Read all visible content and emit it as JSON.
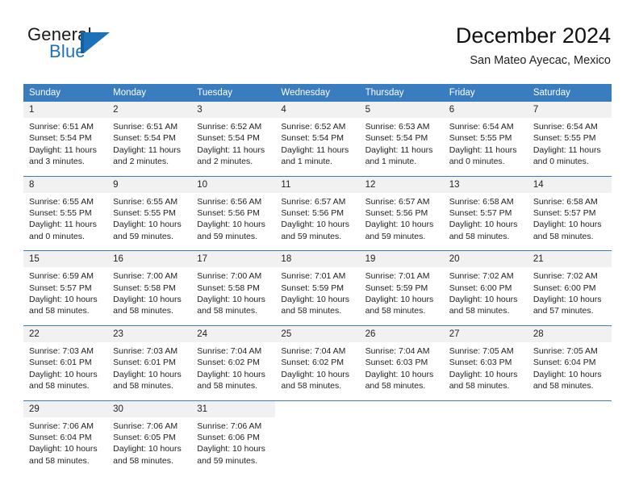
{
  "brand": {
    "name_top": "General",
    "name_bottom": "Blue",
    "accent_color": "#1d71b8",
    "mark_icon": "triangle-logo-icon"
  },
  "header": {
    "title": "December 2024",
    "subtitle": "San Mateo Ayecac, Mexico"
  },
  "calendar": {
    "header_color": "#3a7cc0",
    "daynum_bg": "#f1f1f1",
    "weekday_headers": [
      "Sunday",
      "Monday",
      "Tuesday",
      "Wednesday",
      "Thursday",
      "Friday",
      "Saturday"
    ],
    "weeks": [
      [
        {
          "day": "1",
          "sunrise": "Sunrise: 6:51 AM",
          "sunset": "Sunset: 5:54 PM",
          "daylight": "Daylight: 11 hours and 3 minutes."
        },
        {
          "day": "2",
          "sunrise": "Sunrise: 6:51 AM",
          "sunset": "Sunset: 5:54 PM",
          "daylight": "Daylight: 11 hours and 2 minutes."
        },
        {
          "day": "3",
          "sunrise": "Sunrise: 6:52 AM",
          "sunset": "Sunset: 5:54 PM",
          "daylight": "Daylight: 11 hours and 2 minutes."
        },
        {
          "day": "4",
          "sunrise": "Sunrise: 6:52 AM",
          "sunset": "Sunset: 5:54 PM",
          "daylight": "Daylight: 11 hours and 1 minute."
        },
        {
          "day": "5",
          "sunrise": "Sunrise: 6:53 AM",
          "sunset": "Sunset: 5:54 PM",
          "daylight": "Daylight: 11 hours and 1 minute."
        },
        {
          "day": "6",
          "sunrise": "Sunrise: 6:54 AM",
          "sunset": "Sunset: 5:55 PM",
          "daylight": "Daylight: 11 hours and 0 minutes."
        },
        {
          "day": "7",
          "sunrise": "Sunrise: 6:54 AM",
          "sunset": "Sunset: 5:55 PM",
          "daylight": "Daylight: 11 hours and 0 minutes."
        }
      ],
      [
        {
          "day": "8",
          "sunrise": "Sunrise: 6:55 AM",
          "sunset": "Sunset: 5:55 PM",
          "daylight": "Daylight: 11 hours and 0 minutes."
        },
        {
          "day": "9",
          "sunrise": "Sunrise: 6:55 AM",
          "sunset": "Sunset: 5:55 PM",
          "daylight": "Daylight: 10 hours and 59 minutes."
        },
        {
          "day": "10",
          "sunrise": "Sunrise: 6:56 AM",
          "sunset": "Sunset: 5:56 PM",
          "daylight": "Daylight: 10 hours and 59 minutes."
        },
        {
          "day": "11",
          "sunrise": "Sunrise: 6:57 AM",
          "sunset": "Sunset: 5:56 PM",
          "daylight": "Daylight: 10 hours and 59 minutes."
        },
        {
          "day": "12",
          "sunrise": "Sunrise: 6:57 AM",
          "sunset": "Sunset: 5:56 PM",
          "daylight": "Daylight: 10 hours and 59 minutes."
        },
        {
          "day": "13",
          "sunrise": "Sunrise: 6:58 AM",
          "sunset": "Sunset: 5:57 PM",
          "daylight": "Daylight: 10 hours and 58 minutes."
        },
        {
          "day": "14",
          "sunrise": "Sunrise: 6:58 AM",
          "sunset": "Sunset: 5:57 PM",
          "daylight": "Daylight: 10 hours and 58 minutes."
        }
      ],
      [
        {
          "day": "15",
          "sunrise": "Sunrise: 6:59 AM",
          "sunset": "Sunset: 5:57 PM",
          "daylight": "Daylight: 10 hours and 58 minutes."
        },
        {
          "day": "16",
          "sunrise": "Sunrise: 7:00 AM",
          "sunset": "Sunset: 5:58 PM",
          "daylight": "Daylight: 10 hours and 58 minutes."
        },
        {
          "day": "17",
          "sunrise": "Sunrise: 7:00 AM",
          "sunset": "Sunset: 5:58 PM",
          "daylight": "Daylight: 10 hours and 58 minutes."
        },
        {
          "day": "18",
          "sunrise": "Sunrise: 7:01 AM",
          "sunset": "Sunset: 5:59 PM",
          "daylight": "Daylight: 10 hours and 58 minutes."
        },
        {
          "day": "19",
          "sunrise": "Sunrise: 7:01 AM",
          "sunset": "Sunset: 5:59 PM",
          "daylight": "Daylight: 10 hours and 58 minutes."
        },
        {
          "day": "20",
          "sunrise": "Sunrise: 7:02 AM",
          "sunset": "Sunset: 6:00 PM",
          "daylight": "Daylight: 10 hours and 58 minutes."
        },
        {
          "day": "21",
          "sunrise": "Sunrise: 7:02 AM",
          "sunset": "Sunset: 6:00 PM",
          "daylight": "Daylight: 10 hours and 57 minutes."
        }
      ],
      [
        {
          "day": "22",
          "sunrise": "Sunrise: 7:03 AM",
          "sunset": "Sunset: 6:01 PM",
          "daylight": "Daylight: 10 hours and 58 minutes."
        },
        {
          "day": "23",
          "sunrise": "Sunrise: 7:03 AM",
          "sunset": "Sunset: 6:01 PM",
          "daylight": "Daylight: 10 hours and 58 minutes."
        },
        {
          "day": "24",
          "sunrise": "Sunrise: 7:04 AM",
          "sunset": "Sunset: 6:02 PM",
          "daylight": "Daylight: 10 hours and 58 minutes."
        },
        {
          "day": "25",
          "sunrise": "Sunrise: 7:04 AM",
          "sunset": "Sunset: 6:02 PM",
          "daylight": "Daylight: 10 hours and 58 minutes."
        },
        {
          "day": "26",
          "sunrise": "Sunrise: 7:04 AM",
          "sunset": "Sunset: 6:03 PM",
          "daylight": "Daylight: 10 hours and 58 minutes."
        },
        {
          "day": "27",
          "sunrise": "Sunrise: 7:05 AM",
          "sunset": "Sunset: 6:03 PM",
          "daylight": "Daylight: 10 hours and 58 minutes."
        },
        {
          "day": "28",
          "sunrise": "Sunrise: 7:05 AM",
          "sunset": "Sunset: 6:04 PM",
          "daylight": "Daylight: 10 hours and 58 minutes."
        }
      ],
      [
        {
          "day": "29",
          "sunrise": "Sunrise: 7:06 AM",
          "sunset": "Sunset: 6:04 PM",
          "daylight": "Daylight: 10 hours and 58 minutes."
        },
        {
          "day": "30",
          "sunrise": "Sunrise: 7:06 AM",
          "sunset": "Sunset: 6:05 PM",
          "daylight": "Daylight: 10 hours and 58 minutes."
        },
        {
          "day": "31",
          "sunrise": "Sunrise: 7:06 AM",
          "sunset": "Sunset: 6:06 PM",
          "daylight": "Daylight: 10 hours and 59 minutes."
        },
        {
          "day": "",
          "sunrise": "",
          "sunset": "",
          "daylight": ""
        },
        {
          "day": "",
          "sunrise": "",
          "sunset": "",
          "daylight": ""
        },
        {
          "day": "",
          "sunrise": "",
          "sunset": "",
          "daylight": ""
        },
        {
          "day": "",
          "sunrise": "",
          "sunset": "",
          "daylight": ""
        }
      ]
    ]
  }
}
